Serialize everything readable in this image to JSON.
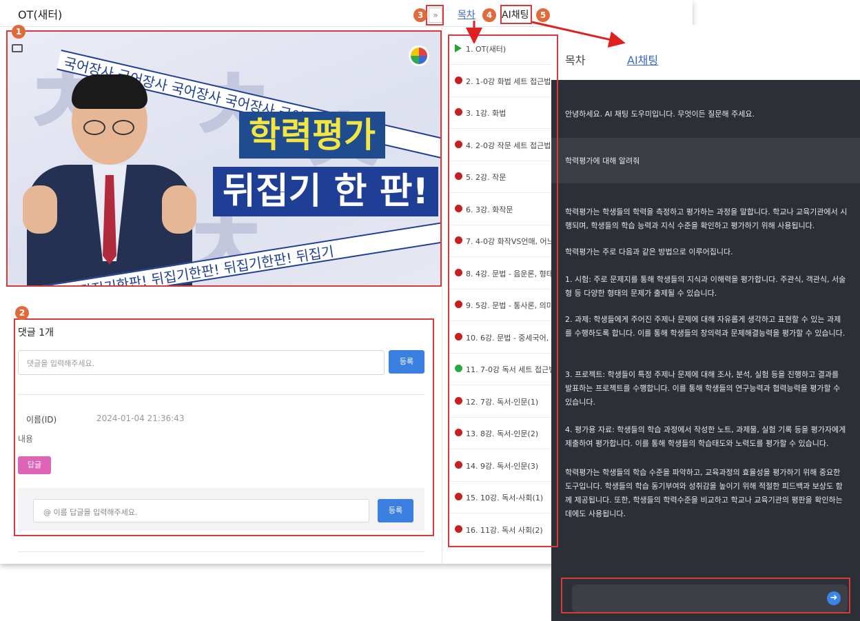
{
  "page": {
    "title": "OT(새터)",
    "toc_toggle": "»",
    "tab_toc": "목차",
    "tab_ai": "AI채팅"
  },
  "badges": [
    "1",
    "2",
    "3",
    "4",
    "5"
  ],
  "video": {
    "banner_top": "국어장사 국어장사 국어장사 국어장사 국어장사 국어장사",
    "banner_bottom": "뒤집기한판! 뒤집기한판! 뒤집기한판! 뒤집기한판! 뒤집기",
    "title_line1": "학력평가",
    "title_line2": "뒤집기 한 판!"
  },
  "comments": {
    "count_label": "댓글 1개",
    "input_placeholder": "댓글을 입력해주세요.",
    "submit_label": "등록",
    "item": {
      "name": "이름(ID)",
      "date": "2024-01-04 21:36:43",
      "body": "내용",
      "reply_button": "답글"
    },
    "reply_placeholder": "@ 이름 답글을 입력해주세요.",
    "reply_submit": "등록"
  },
  "toc": {
    "items": [
      {
        "label": "1. OT(새터)",
        "status": "playing"
      },
      {
        "label": "2. 1-0강 화법 세트 접근법",
        "status": "red"
      },
      {
        "label": "3. 1강. 화법",
        "status": "red"
      },
      {
        "label": "4. 2-0강 작문 세트 접근법",
        "status": "red"
      },
      {
        "label": "5. 2강. 작문",
        "status": "red"
      },
      {
        "label": "6. 3강. 화작문",
        "status": "red"
      },
      {
        "label": "7. 4-0강 화작VS언매, 어느",
        "status": "red"
      },
      {
        "label": "8. 4강. 문법 - 음운론, 형태",
        "status": "red"
      },
      {
        "label": "9. 5강. 문법 - 통사론, 의미",
        "status": "red"
      },
      {
        "label": "10. 6강. 문법 - 중세국어, ",
        "status": "red"
      },
      {
        "label": "11. 7-0강 독서 세트 접근법",
        "status": "green"
      },
      {
        "label": "12. 7강. 독서-인문(1)",
        "status": "red"
      },
      {
        "label": "13. 8강. 독서-인문(2)",
        "status": "red"
      },
      {
        "label": "14. 9강. 독서-인문(3)",
        "status": "red"
      },
      {
        "label": "15. 10강. 독서-사회(1)",
        "status": "red"
      },
      {
        "label": "16. 11강. 독서 사회(2)",
        "status": "red"
      }
    ]
  },
  "chat": {
    "tab_toc": "목차",
    "tab_ai": "AI채팅",
    "greeting": "안녕하세요. AI 채팅 도우미입니다. 무엇이든 질문해 주세요.",
    "question": "학력평가에 대해 알려줘",
    "answer": [
      "학력평가는 학생들의 학력을 측정하고 평가하는 과정을 말합니다. 학교나 교육기관에서 시행되며, 학생들의 학습 능력과 지식 수준을 확인하고 평가하기 위해 사용됩니다.",
      "학력평가는 주로 다음과 같은 방법으로 이루어집니다.",
      "1. 시험: 주로 문제지를 통해 학생들의 지식과 이해력을 평가합니다. 주관식, 객관식, 서술형 등 다양한 형태의 문제가 출제될 수 있습니다.",
      "2. 과제: 학생들에게 주어진 주제나 문제에 대해 자유롭게 생각하고 표현할 수 있는 과제를 수행하도록 합니다. 이를 통해 학생들의 창의력과 문제해결능력을 평가할 수 있습니다.",
      "3. 프로젝트: 학생들이 특정 주제나 문제에 대해 조사, 분석, 실험 등을 진행하고 결과를 발표하는 프로젝트를 수행합니다. 이를 통해 학생들의 연구능력과 협력능력을 평가할 수 있습니다.",
      "4. 평가용 자료: 학생들의 학습 과정에서 작성한 노트, 과제물, 실험 기록 등을 평가자에게 제출하여 평가합니다. 이를 통해 학생들의 학습태도와 노력도를 평가할 수 있습니다.",
      "학력평가는 학생들의 학습 수준을 파악하고, 교육과정의 효율성을 평가하기 위해 중요한 도구입니다. 학생들의 학습 동기부여와 성취감을 높이기 위해 적절한 피드백과 보상도 함께 제공됩니다. 또한, 학생들의 학력수준을 비교하고 학교나 교육기관의 평판을 확인하는데에도 사용됩니다."
    ]
  },
  "colors": {
    "accent_red": "#d8393d",
    "badge_orange": "#e06a3a",
    "link_blue": "#3a67c8",
    "button_blue": "#3b7fe0",
    "button_pink": "#e064b6",
    "chat_bg": "#2d2f36"
  },
  "icons": [
    "cast-icon",
    "logo-icon",
    "play-icon",
    "status-dot-icon",
    "send-icon"
  ]
}
